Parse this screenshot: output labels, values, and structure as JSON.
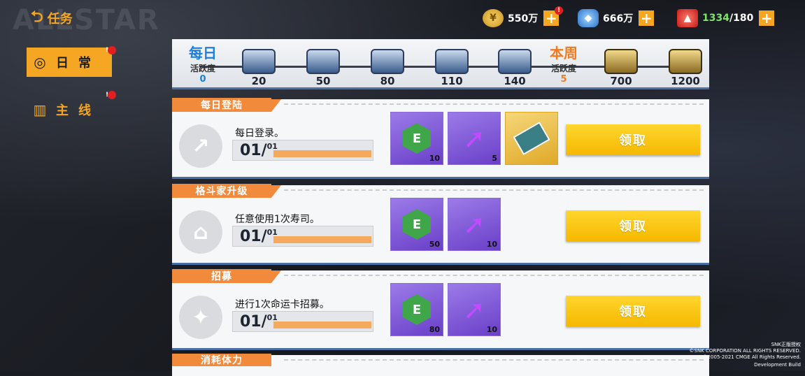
{
  "header": {
    "watermark": "ALLSTAR",
    "back_label": "任务",
    "gold": "550万",
    "gems": "666万",
    "stamina_current": "1334",
    "stamina_max": "/180",
    "gold_badge": "!"
  },
  "nav": {
    "items": [
      {
        "label": "日常",
        "active": true,
        "badge": "!"
      },
      {
        "label": "主线",
        "active": false,
        "badge": "!"
      }
    ]
  },
  "progress": {
    "daily_title": "每日",
    "daily_sub": "活跃度",
    "daily_value": "0",
    "weekly_title": "本周",
    "weekly_sub": "活跃度",
    "weekly_value": "5",
    "daily_milestones": [
      "20",
      "50",
      "80",
      "110",
      "140"
    ],
    "weekly_milestones": [
      "700",
      "1200"
    ]
  },
  "tasks": [
    {
      "title": "每日登陆",
      "description": "每日登录。",
      "current": "01/",
      "total": "01",
      "progress": 1.0,
      "rewards": [
        {
          "icon": "exp-hex-icon",
          "qty": "10",
          "type": "purple"
        },
        {
          "icon": "upgrade-arrow-icon",
          "qty": "5",
          "type": "purple"
        },
        {
          "icon": "ticket-icon",
          "qty": "",
          "type": "gold"
        }
      ],
      "button": "领取"
    },
    {
      "title": "格斗家升级",
      "description": "任意使用1次寿司。",
      "current": "01/",
      "total": "01",
      "progress": 1.0,
      "rewards": [
        {
          "icon": "exp-hex-icon",
          "qty": "50",
          "type": "purple"
        },
        {
          "icon": "upgrade-arrow-icon",
          "qty": "10",
          "type": "purple"
        }
      ],
      "button": "领取"
    },
    {
      "title": "招募",
      "description": "进行1次命运卡招募。",
      "current": "01/",
      "total": "01",
      "progress": 1.0,
      "rewards": [
        {
          "icon": "exp-hex-icon",
          "qty": "80",
          "type": "purple"
        },
        {
          "icon": "upgrade-arrow-icon",
          "qty": "10",
          "type": "purple"
        }
      ],
      "button": "领取"
    }
  ],
  "task4_title": "消耗体力",
  "copyright": [
    "SNK正版授权",
    "©SNK CORPORATION ALL RIGHTS RESERVED.",
    "©2005-2021 CMGE All Rights Reserved.",
    "Development Build"
  ],
  "colors": {
    "accent": "#f5a623",
    "task_title": "#f28a3c",
    "button": "#ffd62e",
    "daily_blue": "#1e7fd6",
    "weekly_orange": "#f07a20"
  }
}
